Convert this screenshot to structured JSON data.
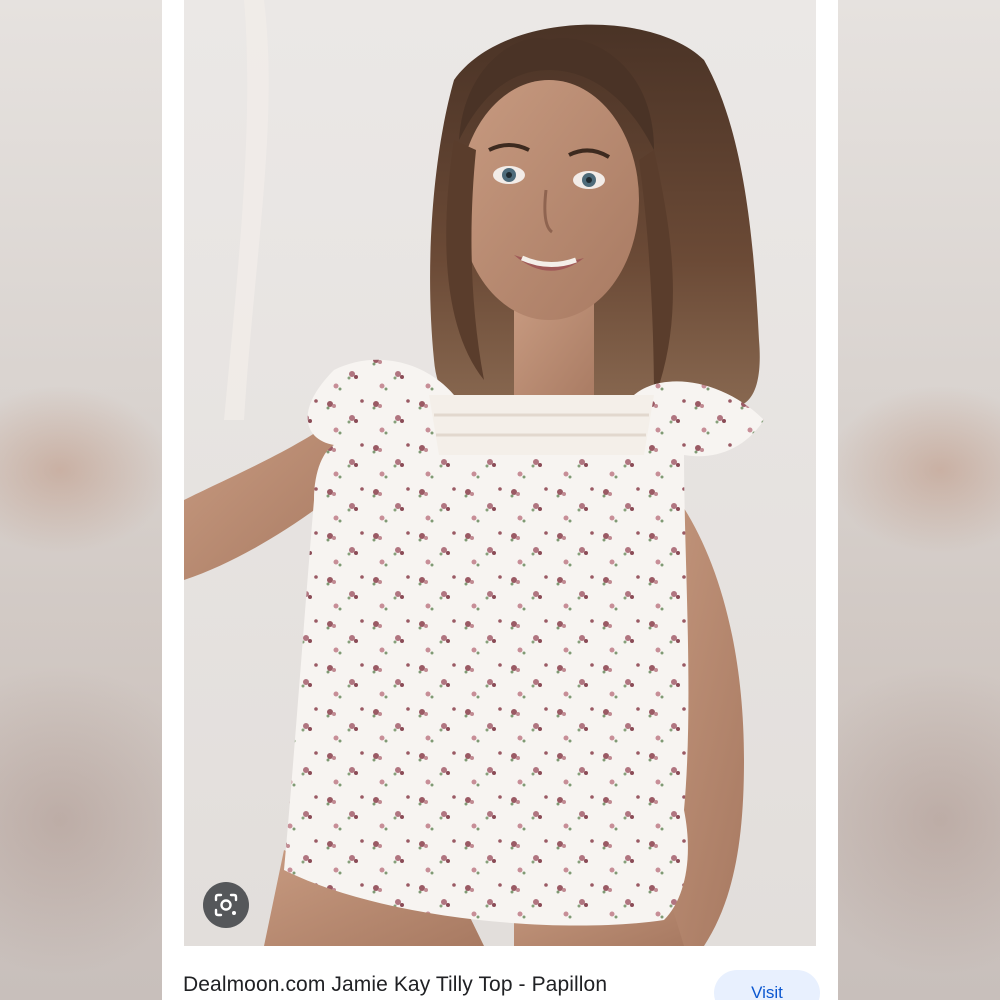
{
  "result": {
    "title": "Dealmoon.com Jamie Kay Tilly Top - Papillon",
    "visit_label": "Visit"
  },
  "icons": {
    "lens": "google-lens-icon"
  },
  "colors": {
    "visit_bg": "#e8f0fe",
    "visit_text": "#0b57d0",
    "title_text": "#202124"
  }
}
